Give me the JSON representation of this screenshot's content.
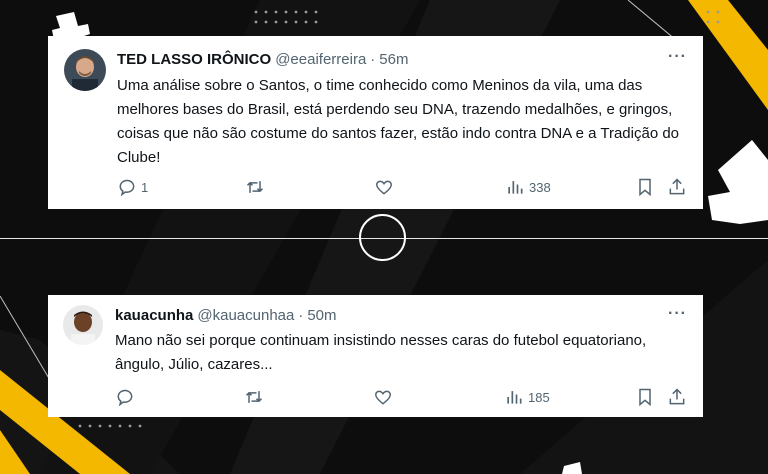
{
  "colors": {
    "background": "#0d0d0d",
    "accent_yellow": "#f5b800",
    "card": "#ffffff",
    "text_primary": "#0f1419",
    "text_secondary": "#536471"
  },
  "tweets": [
    {
      "author_name": "TED LASSO IRÔNICO",
      "handle": "@eeaiferreira",
      "time": "56m",
      "text": "Uma análise sobre o Santos, o time conhecido como Meninos da vila, uma das melhores bases do Brasil, está perdendo seu DNA, trazendo medalhões, e gringos, coisas que não são costume do santos fazer, estão indo contra DNA e a Tradição do Clube!",
      "reply_count": "1",
      "views": "338",
      "more_label": "···"
    },
    {
      "author_name": "kauacunha",
      "handle": "@kauacunhaa",
      "time": "50m",
      "text": "Mano não sei porque continuam insistindo nesses caras do futebol equatoriano, ângulo, Júlio, cazares...",
      "views": "185",
      "more_label": "···"
    }
  ],
  "meta_separator": "·",
  "icons": [
    "reply-icon",
    "retweet-icon",
    "like-icon",
    "views-icon",
    "bookmark-icon",
    "share-icon",
    "more-icon"
  ]
}
